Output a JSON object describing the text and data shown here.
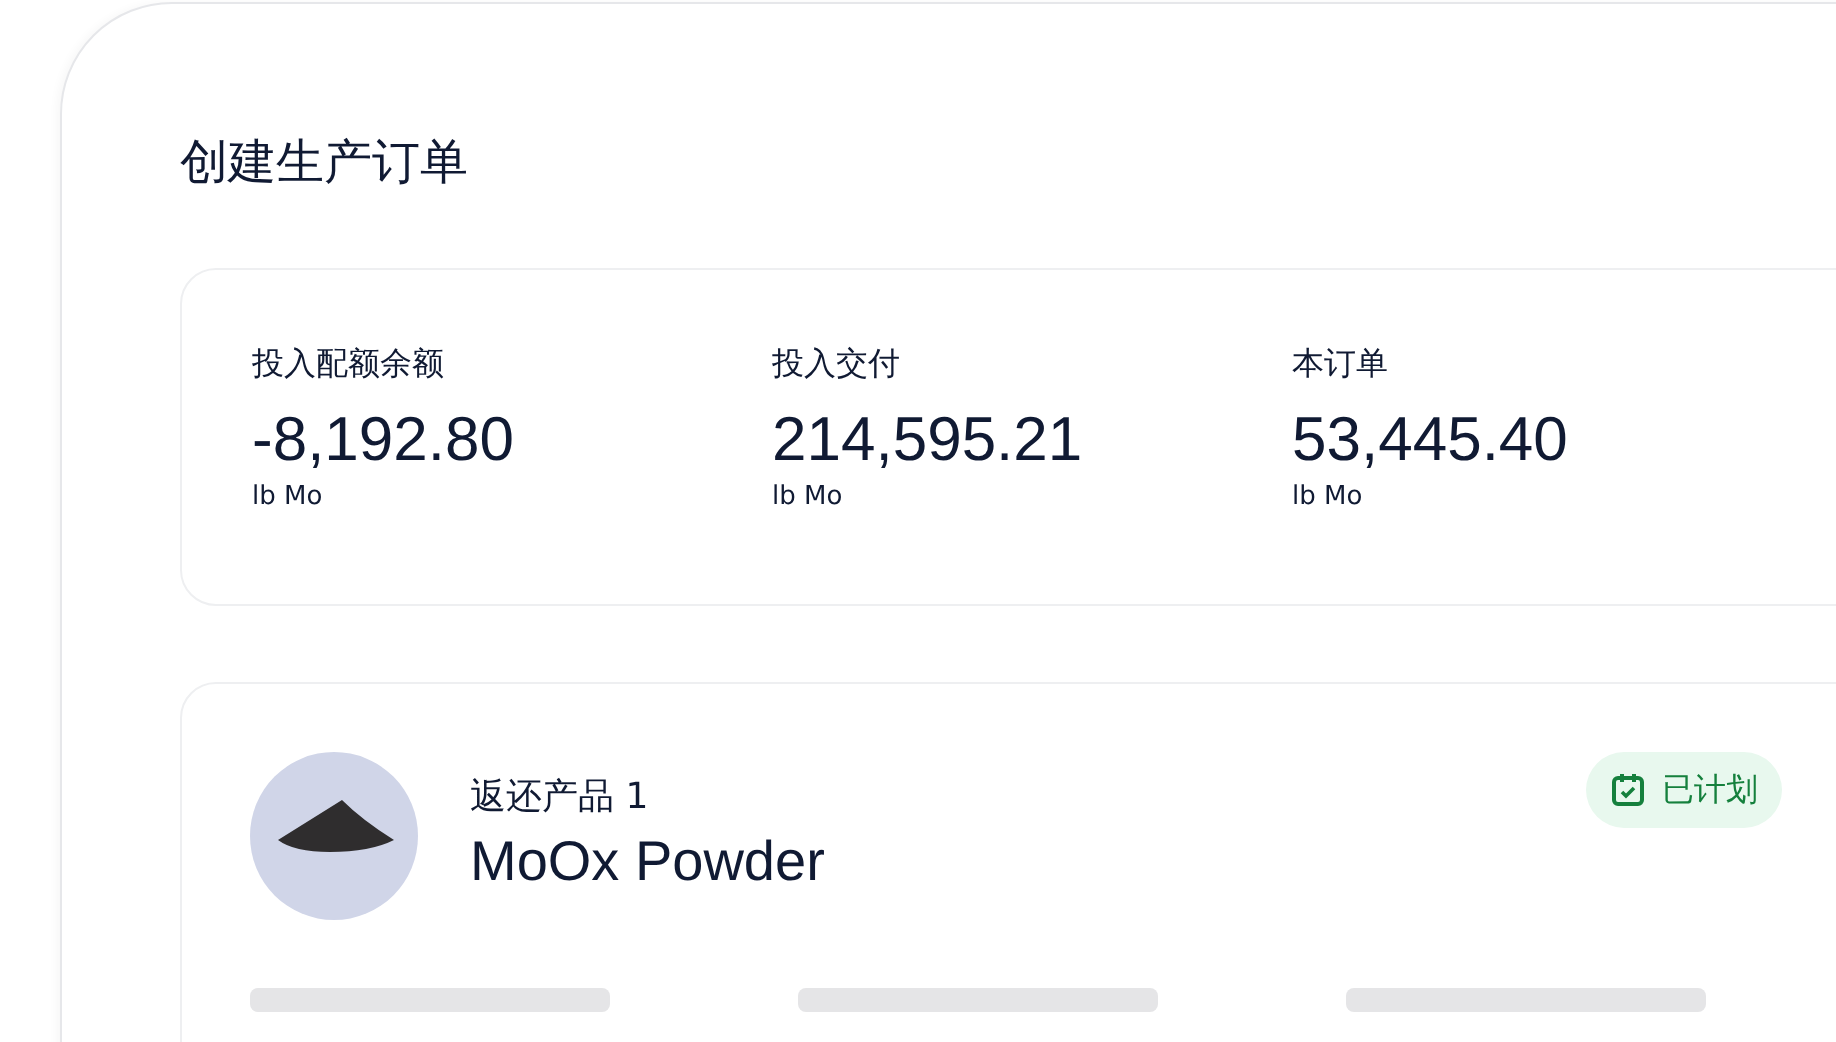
{
  "title": "创建生产订单",
  "stats": [
    {
      "label": "投入配额余额",
      "value": "-8,192.80",
      "unit": "lb Mo"
    },
    {
      "label": "投入交付",
      "value": "214,595.21",
      "unit": "lb Mo"
    },
    {
      "label": "本订单",
      "value": "53,445.40",
      "unit": "lb Mo"
    }
  ],
  "product": {
    "label": "返还产品 1",
    "name": "MoOx Powder",
    "status": {
      "kind": "scheduled",
      "label": "已计划"
    }
  }
}
